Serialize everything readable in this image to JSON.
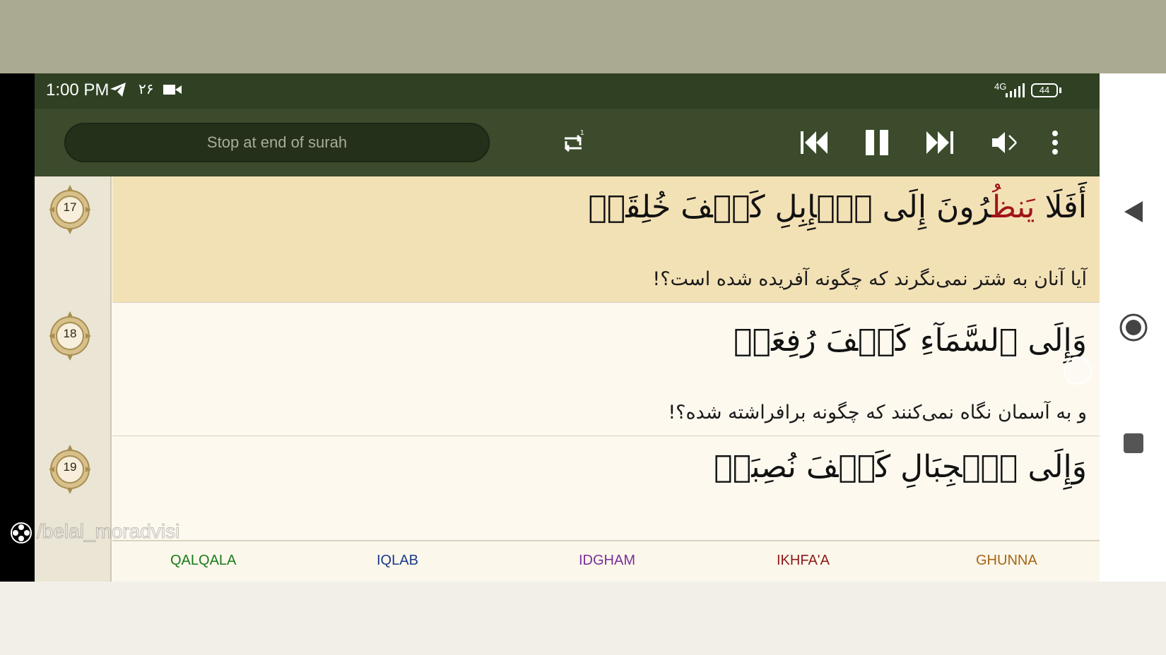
{
  "status_bar": {
    "time": "1:00 PM",
    "notif_count": "۲۶",
    "network": "4G",
    "battery": "44",
    "icons": [
      "telegram-icon",
      "video-camera-icon",
      "signal-icon",
      "battery-icon"
    ]
  },
  "toolbar": {
    "stop_label": "Stop at end of surah",
    "buttons": [
      "repeat-once-icon",
      "skip-previous-icon",
      "pause-icon",
      "skip-next-icon",
      "volume-off-icon",
      "more-vert-icon"
    ]
  },
  "verses": [
    {
      "number": "17",
      "arabic_start": "أَفَلَا ",
      "arabic_highlight": "يَنظُ",
      "arabic_end": "رُونَ إِلَى ٱلۡإِبِلِ كَيۡفَ خُلِقَتۡ",
      "translation": "آیا آنان به شتر نمی‌نگرند که چگونه آفریده شده است؟!"
    },
    {
      "number": "18",
      "arabic": "وَإِلَى ٱلسَّمَآءِ كَيۡفَ رُفِعَتۡ",
      "translation": "و به آسمان نگاه نمی‌کنند که چگونه برافراشته شده؟!"
    },
    {
      "number": "19",
      "arabic": "وَإِلَى ٱلۡجِبَالِ كَيۡفَ نُصِبَتۡ"
    }
  ],
  "tajweed": [
    {
      "label": "QALQALA",
      "color": "#1b7a1b"
    },
    {
      "label": "IQLAB",
      "color": "#1a3a8c"
    },
    {
      "label": "IDGHAM",
      "color": "#7a2f9e"
    },
    {
      "label": "IKHFA'A",
      "color": "#8c1a1a"
    },
    {
      "label": "GHUNNA",
      "color": "#a86414"
    }
  ],
  "watermark": "/belal_moradvisi",
  "colors": {
    "status_bar": "#2f4122",
    "toolbar": "#3b4b2b",
    "active_verse": "#f3e1b6",
    "verse_bg": "#fdf9ef"
  },
  "nav_buttons": [
    "back-triangle-icon",
    "home-circle-icon",
    "recents-square-icon"
  ]
}
